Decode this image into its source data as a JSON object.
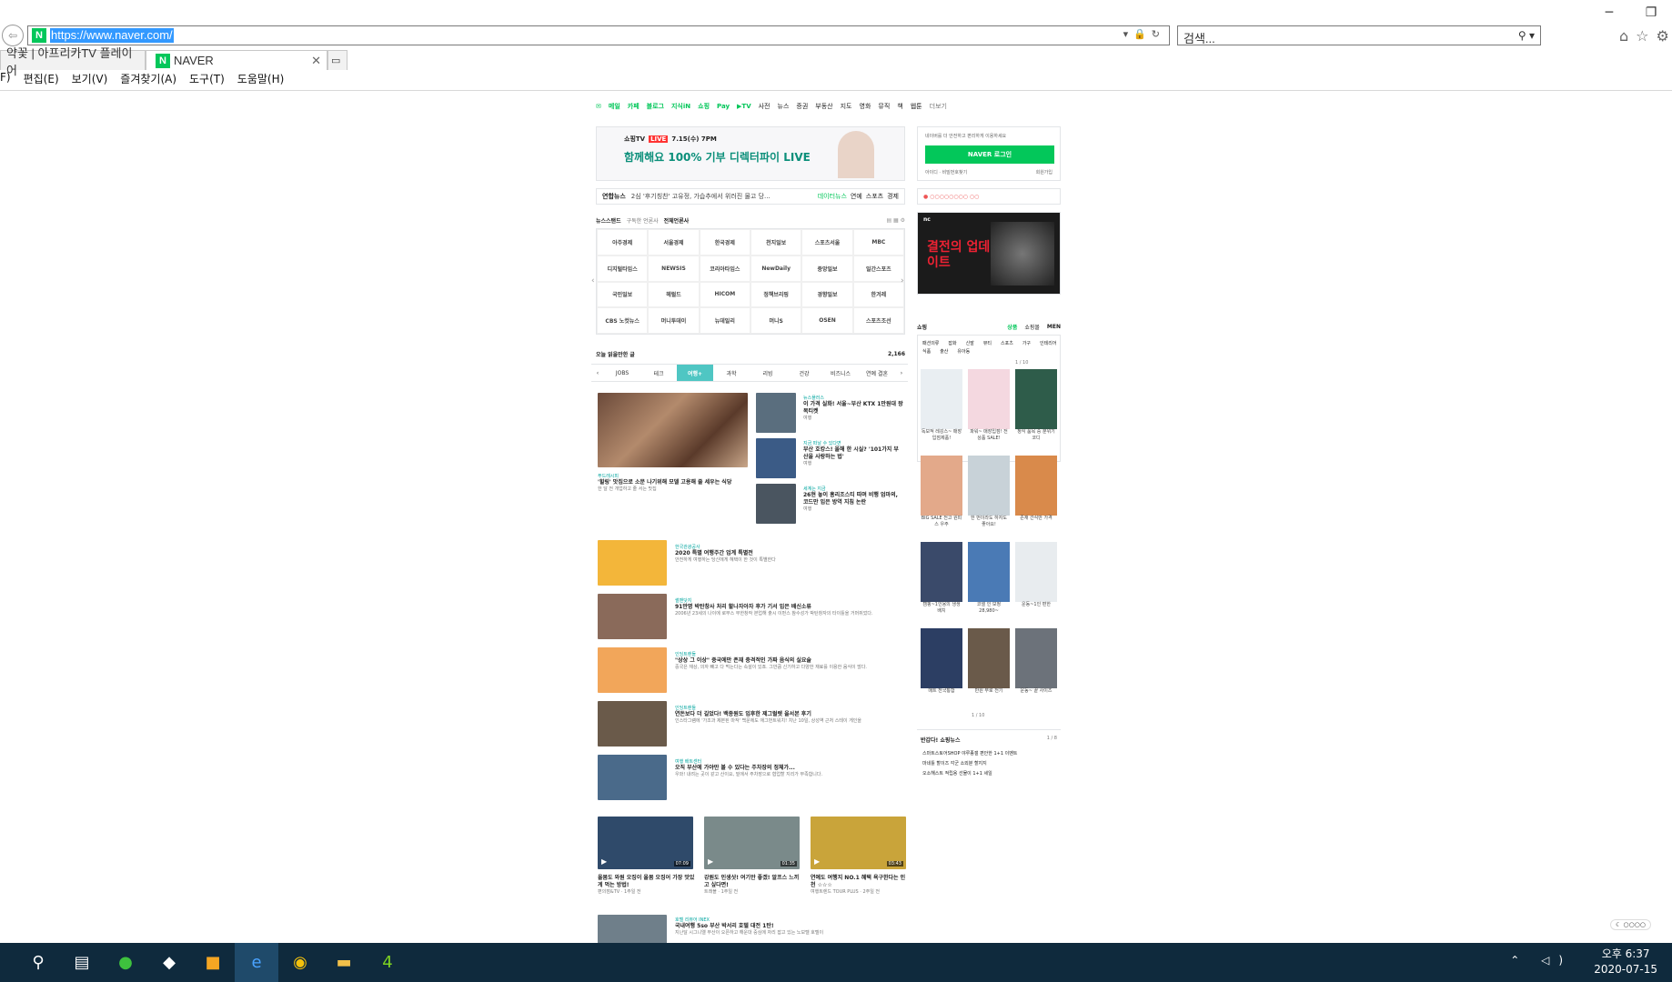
{
  "browser": {
    "url": "https://www.naver.com/",
    "search_placeholder": "검색...",
    "tabs": [
      {
        "label": "약꽃 | 아프리카TV 플레이어"
      },
      {
        "label": "NAVER"
      }
    ],
    "menu": [
      "F)",
      "편집(E)",
      "보기(V)",
      "즐겨찾기(A)",
      "도구(T)",
      "도움말(H)"
    ]
  },
  "naver": {
    "gnb": [
      "메일",
      "카페",
      "블로그",
      "지식iN",
      "쇼핑",
      "Pay",
      "▶TV",
      "사전",
      "뉴스",
      "증권",
      "부동산",
      "지도",
      "영화",
      "뮤직",
      "책",
      "웹툰",
      "더보기"
    ],
    "banner": {
      "brand": "쇼핑TV",
      "live": "LIVE",
      "date": "7.15(수) 7PM",
      "headline": "함께해요 100% 기부 디렉터파이 LIVE"
    },
    "login": {
      "desc": "네이버를 더 안전하고 편리하게 이용하세요",
      "button": "NAVER 로그인",
      "find": "아이디 · 비밀번호찾기",
      "join": "회원가입"
    },
    "newsbar": {
      "label": "연합뉴스",
      "headline": "2심 '후기칭찬' 고유정, 가습추에서 위러진 물고 당...",
      "links": [
        "데이터뉴스",
        "연예",
        "스포츠",
        "경제"
      ]
    },
    "newsstand": {
      "title": "뉴스스탠드",
      "sub": "구독한 언론사",
      "all": "전체언론사",
      "press": [
        "아주경제",
        "서울경제",
        "한국경제",
        "천지일보",
        "스포츠서울",
        "MBC",
        "디지털타임스",
        "NEWSIS",
        "코리아타임스",
        "NewDaily",
        "중앙일보",
        "일간스포츠",
        "국민일보",
        "헤럴드",
        "HICOM",
        "정책브리핑",
        "경향일보",
        "한겨레",
        "CBS 노컷뉴스",
        "머니투데이",
        "뉴데일리",
        "머니S",
        "OSEN",
        "스포츠조선"
      ]
    },
    "today": {
      "title": "오늘 읽을만한 글",
      "count": "2,166",
      "tabs": [
        "JOBS",
        "테크",
        "여행+",
        "과학",
        "리빙",
        "건강",
        "비즈니스",
        "연예 결혼"
      ],
      "selected": "여행+"
    },
    "feature": {
      "cat": "푸드레시피",
      "title": "'힐링' 맛집으로 소문 나기위해 모델 고용해 줄 세우는 식당",
      "body": "한 달 전 개업하고 줄 서는 맛집"
    },
    "side_articles": [
      {
        "cat": "뉴스플러스",
        "title": "이 가격 실화! 서울~부산 KTX 1만원대 왕복티켓",
        "meta": "여행"
      },
      {
        "cat": "지금 떠날 수 있다면",
        "title": "부산 호캉스! 올해 한 시실? '101가지 부산을 사랑하는 법'",
        "meta": "여행"
      },
      {
        "cat": "세계는 지금",
        "title": "26현 놓이 홍리조스티 따며 비행 엄마의, 코드만 입은 방역 지침 논란",
        "meta": "여행"
      }
    ],
    "list_articles": [
      {
        "cat": "한국관광공사",
        "title": "2020 특별 여행주간 업계 특별전",
        "body": "안전하게 여행하는 당신에게 혜택이 한 것이 특별한다"
      },
      {
        "cat": "썰맨닷지",
        "title": "91만명 박탄창사 처리 할나자아자 후가 기서 입은 배신소류",
        "body": "2006년 23세의 나이에 로부스 무한창작 본업해 출시 이펀스 참수성가 박탄창자의 타이틀을 거머쥐었다."
      },
      {
        "cat": "인딩트렌들",
        "title": "\"상상 그 이상\" 중국에만 존재 충격적인 가짜 음식의 실요술",
        "body": "중국은 재상, 의자 빼고 다 먹는다는 속설이 있죠. 그만큼 신기하고 다양한 재료를 이용한 음식이 많다."
      },
      {
        "cat": "인딩트렌들",
        "title": "연돈보다 더 길었다! 백종원도 입후한 제그럴렛 을서본 후기",
        "body": "인스타그램에 '가조과 제본된 마작' 백문에도 애그번트워치! 치난 10일, 상성역 근처 스테이 게인을"
      },
      {
        "cat": "여행 배트센터",
        "title": "오직 부산에 가야만 볼 수 있다는 주차장의 정체가...",
        "body": "우와! 내려는 곳이 같고 산이요, 밑에서 주차장으로 협업할 지리가 부족합니다."
      }
    ],
    "videos": [
      {
        "title": "올봄도 와원 오징이 올봄 오징어 가장 맛있게 먹는 방법!",
        "dur": "07:09",
        "meta": "편의점&TV · 1주일 전"
      },
      {
        "title": "강원도 인생샷! 여기만 좋겠! 알프스 느끼고 싶다면!",
        "dur": "01:35",
        "meta": "트래블 · 1주일 전"
      },
      {
        "title": "연예도 여행지 NO.1 혜택 욕구한다는 인천 ☆☆☆",
        "dur": "03:43",
        "meta": "여행트렌드 TOUR PLUS · 2주일 전"
      }
    ],
    "bottom_article": {
      "cat": "호텔 리뷰어 INEX",
      "title": "국내여행 5so 부산 박서리 호텔 대전 1탄!",
      "body": "지난달 시그니엘 부산이 오픈하고 해운대 중심에 자리 잡고 있는 노보텔 호텔이"
    },
    "shopping": {
      "title": "쇼핑",
      "tabs": [
        "상품",
        "쇼핑몰",
        "MEN"
      ],
      "cats": [
        "패션의류",
        "잡화",
        "신발",
        "뷰티",
        "스포츠",
        "가구",
        "인테리어",
        "식품",
        "출산",
        "유아동"
      ],
      "page": "1 / 10",
      "items": [
        {
          "caption": "독보적 레깅스~ 매장 입점제품!",
          "color": "#e9eef2"
        },
        {
          "caption": "파워~ 매장입점! 전상품 SALE!",
          "color": "#f4d8e0"
        },
        {
          "caption": "정식 품목 중 분위기 코디",
          "color": "#2e5c4a"
        },
        {
          "caption": "BIG SALE 전고 원피스 우주",
          "color": "#e3a98a"
        },
        {
          "caption": "한 번이라도 하자도 좋아요!",
          "color": "#c8d2d8"
        },
        {
          "caption": "존재 간식만 가격",
          "color": "#d98a4b"
        },
        {
          "caption": "캠핑~1인용의 생생 배치",
          "color": "#3a4a6a"
        },
        {
          "caption": "코넬 인 보정 28,980~",
          "color": "#4a7ab5"
        },
        {
          "caption": "운동~1인 편한",
          "color": "#e8ecef"
        },
        {
          "caption": "매트 전국통합",
          "color": "#2c3e63"
        },
        {
          "caption": "만원 부로 전기",
          "color": "#6a5a4a"
        },
        {
          "caption": "운동~ 끝 사이즈",
          "color": "#6c727a"
        }
      ],
      "bottom_page": "1 / 10",
      "news_title": "반갑다! 쇼핑뉴스",
      "news_page": "1 / 8",
      "news": [
        "스마트스토어SHOP 야루종갤 편안한 1+1 이벤트",
        "마네틀 할이즈 각군 소외분 할지지",
        "오소해스트 적립용 선물이 1+1 세일"
      ]
    },
    "ad_text": "결전의 업데이트"
  },
  "taskbar": {
    "time": "오후 6:37",
    "date": "2020-07-15"
  }
}
